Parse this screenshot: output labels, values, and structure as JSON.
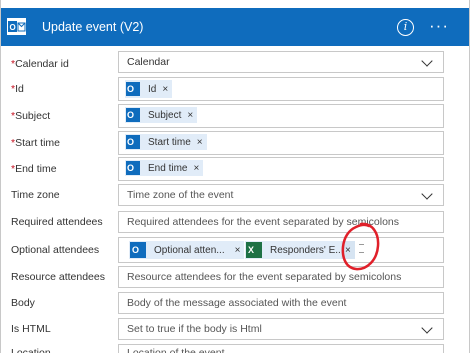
{
  "header": {
    "title": "Update event (V2)",
    "info_icon": "info-icon",
    "more_label": "···",
    "accent": "#0f6cbd"
  },
  "fields": {
    "calendar_id": {
      "label": "Calendar id",
      "required": "*",
      "value": "Calendar"
    },
    "id": {
      "label": "Id",
      "required": "*",
      "token": "Id",
      "token_close": "×"
    },
    "subject": {
      "label": "Subject",
      "required": "*",
      "token": "Subject",
      "token_close": "×"
    },
    "start_time": {
      "label": "Start time",
      "required": "*",
      "token": "Start time",
      "token_close": "×"
    },
    "end_time": {
      "label": "End time",
      "required": "*",
      "token": "End time",
      "token_close": "×"
    },
    "time_zone": {
      "label": "Time zone",
      "placeholder": "Time zone of the event"
    },
    "required_attendees": {
      "label": "Required attendees",
      "placeholder": "Required attendees for the event separated by semicolons"
    },
    "optional_attendees": {
      "label": "Optional attendees",
      "token1": "Optional atten...",
      "token1_close": "×",
      "token2": "Responders' E...",
      "token2_close": "×",
      "token3_close": "×"
    },
    "resource_attendees": {
      "label": "Resource attendees",
      "placeholder": "Resource attendees for the event separated by semicolons"
    },
    "body": {
      "label": "Body",
      "placeholder": "Body of the message associated with the event"
    },
    "is_html": {
      "label": "Is HTML",
      "placeholder": "Set to true if the body is Html"
    },
    "location": {
      "label": "Location",
      "placeholder": "Location of the event"
    }
  },
  "colors": {
    "required": "#c50f1f",
    "token_bg": "#e1ecf8",
    "outlook": "#0f6cbd",
    "excel": "#1e7145",
    "annotation": "#e0202a"
  }
}
